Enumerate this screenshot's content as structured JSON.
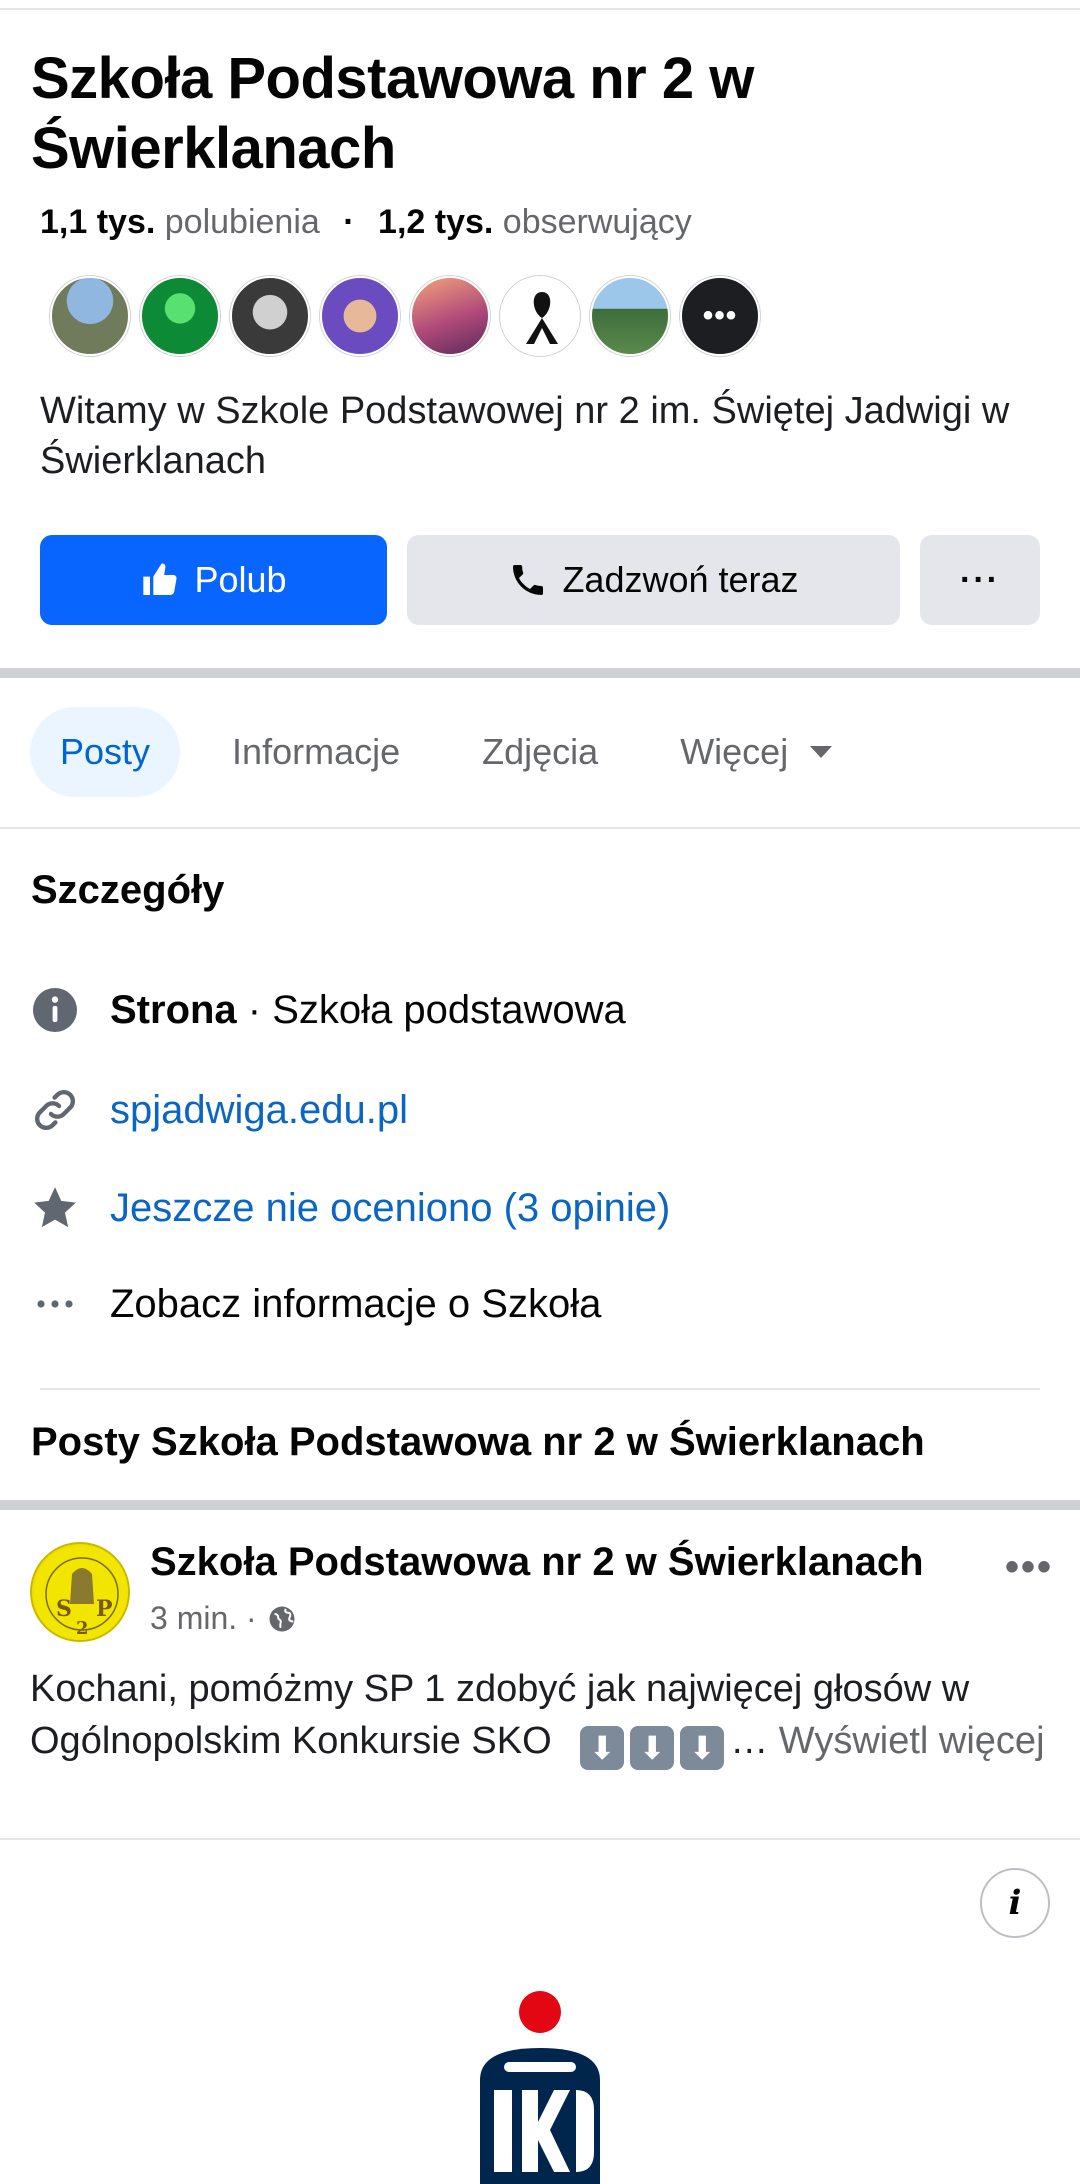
{
  "page": {
    "title": "Szkoła Podstawowa nr 2 w Świerklanach",
    "likes_count": "1,1 tys.",
    "likes_label": "polubienia",
    "followers_count": "1,2 tys.",
    "followers_label": "obserwujący",
    "intro": "Witamy w Szkole Podstawowej nr 2 im. Świętej Jadwigi w Świerklanach"
  },
  "actions": {
    "like": "Polub",
    "call": "Zadzwoń teraz",
    "more": "···"
  },
  "tabs": [
    {
      "label": "Posty",
      "active": true
    },
    {
      "label": "Informacje"
    },
    {
      "label": "Zdjęcia"
    },
    {
      "label": "Więcej"
    }
  ],
  "details": {
    "heading": "Szczegóły",
    "category_label": "Strona",
    "category_value": " · Szkoła podstawowa",
    "website": "spjadwiga.edu.pl",
    "rating": "Jeszcze nie oceniono (3 opinie)",
    "see_more": "Zobacz informacje o Szkoła"
  },
  "posts_heading": "Posty Szkoła Podstawowa nr 2 w Świerklanach",
  "post": {
    "author": "Szkoła Podstawowa nr 2 w Świerklanach",
    "time": "3 min. ·",
    "text": "Kochani, pomóżmy SP 1 zdobyć jak najwięcej głosów w Ogólnopolskim Konkursie SKO",
    "ellipsis": "…",
    "see_more": " Wyświetl więcej",
    "menu": "•••"
  },
  "colors": {
    "accent": "#0866ff",
    "link": "#0a66c2",
    "muted": "#65676b",
    "tab_active_bg": "#ebf5ff"
  }
}
